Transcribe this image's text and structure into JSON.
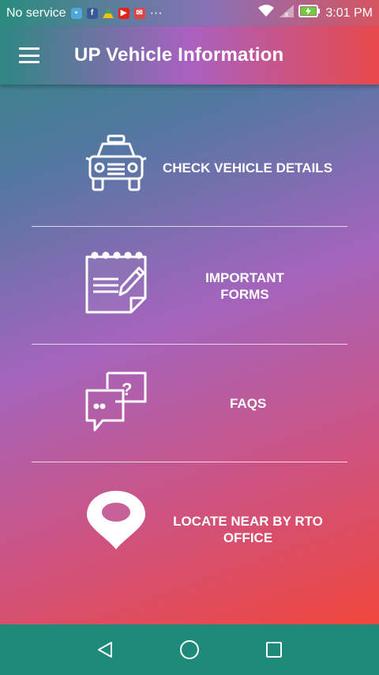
{
  "status_bar": {
    "carrier": "No service",
    "more_indicator": "···",
    "time": "3:01 PM"
  },
  "app_bar": {
    "title": "UP Vehicle Information",
    "menu_icon": "hamburger-menu-icon"
  },
  "menu": {
    "items": [
      {
        "label": "CHECK VEHICLE DETAILS",
        "icon": "car-icon"
      },
      {
        "label": "IMPORTANT FORMS",
        "line1": "IMPORTANT",
        "line2": "FORMS",
        "icon": "notepad-pencil-icon"
      },
      {
        "label": "FAQS",
        "icon": "chat-question-icon"
      },
      {
        "label": "LOCATE NEAR BY RTO OFFICE",
        "icon": "location-pin-icon"
      }
    ]
  },
  "nav_bar": {
    "back": "back-icon",
    "home": "home-icon",
    "recents": "recents-icon"
  },
  "colors": {
    "nav_bar": "#1f8a7a",
    "gradient_start": "#2c8a7e",
    "gradient_mid": "#b260c4",
    "gradient_end": "#f0463c"
  }
}
